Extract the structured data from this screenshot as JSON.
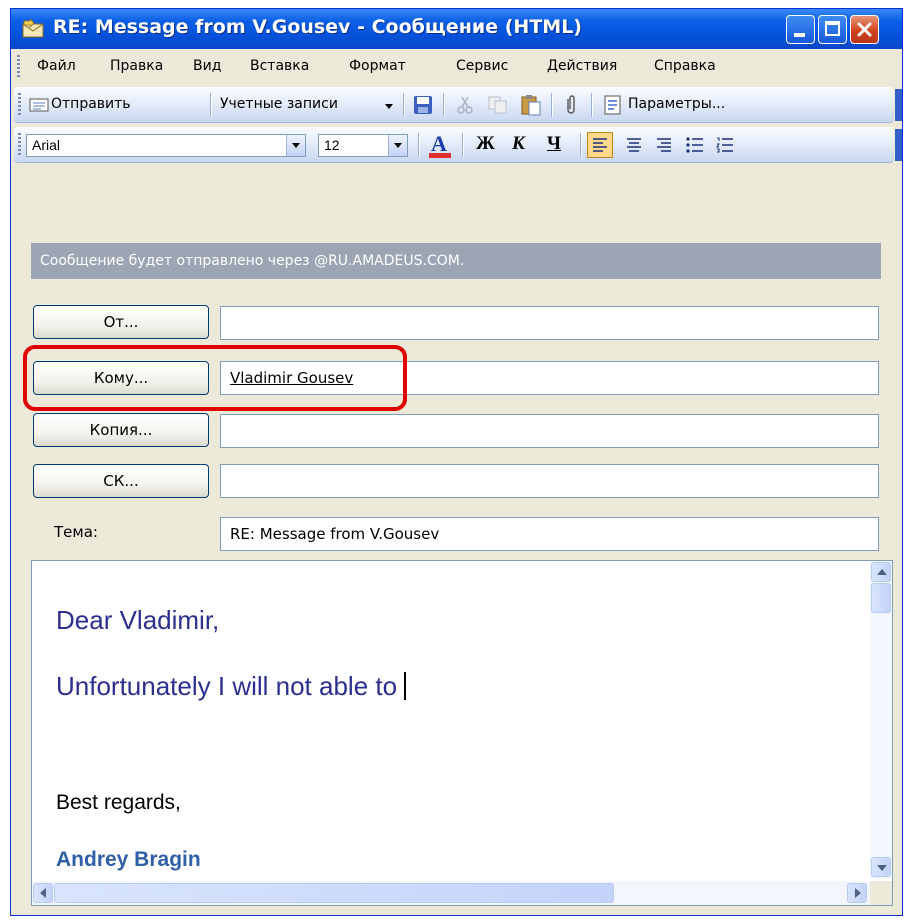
{
  "window": {
    "title": "RE: Message from V.Gousev - Сообщение (HTML)"
  },
  "menu": [
    "Файл",
    "Правка",
    "Вид",
    "Вставка",
    "Формат",
    "Сервис",
    "Действия",
    "Справка"
  ],
  "standard_toolbar": {
    "send_label": "Отправить",
    "accounts_label": "Учетные записи",
    "options_label": "Параметры..."
  },
  "format_toolbar": {
    "font": "Arial",
    "size": "12",
    "bold_label": "Ж",
    "italic_label": "К",
    "underline_label": "Ч",
    "font_color": "#E03030"
  },
  "info_bar": "Сообщение будет отправлено через @RU.AMADEUS.COM.",
  "fields": {
    "from_label": "От...",
    "from_value": "",
    "to_label": "Кому...",
    "to_value": "Vladimir Gousev",
    "cc_label": "Копия...",
    "cc_value": "",
    "bcc_label": "СК...",
    "bcc_value": "",
    "subject_label": "Тема:",
    "subject_value": "RE: Message from V.Gousev"
  },
  "body": {
    "greeting": "Dear Vladimir,",
    "line1": "Unfortunately I will not able to ",
    "closing": "Best regards,",
    "signature": "Andrey Bragin"
  },
  "colors": {
    "body_text": "#2B2F8F",
    "signature": "#2E5FA8",
    "highlight": "#E00000"
  }
}
